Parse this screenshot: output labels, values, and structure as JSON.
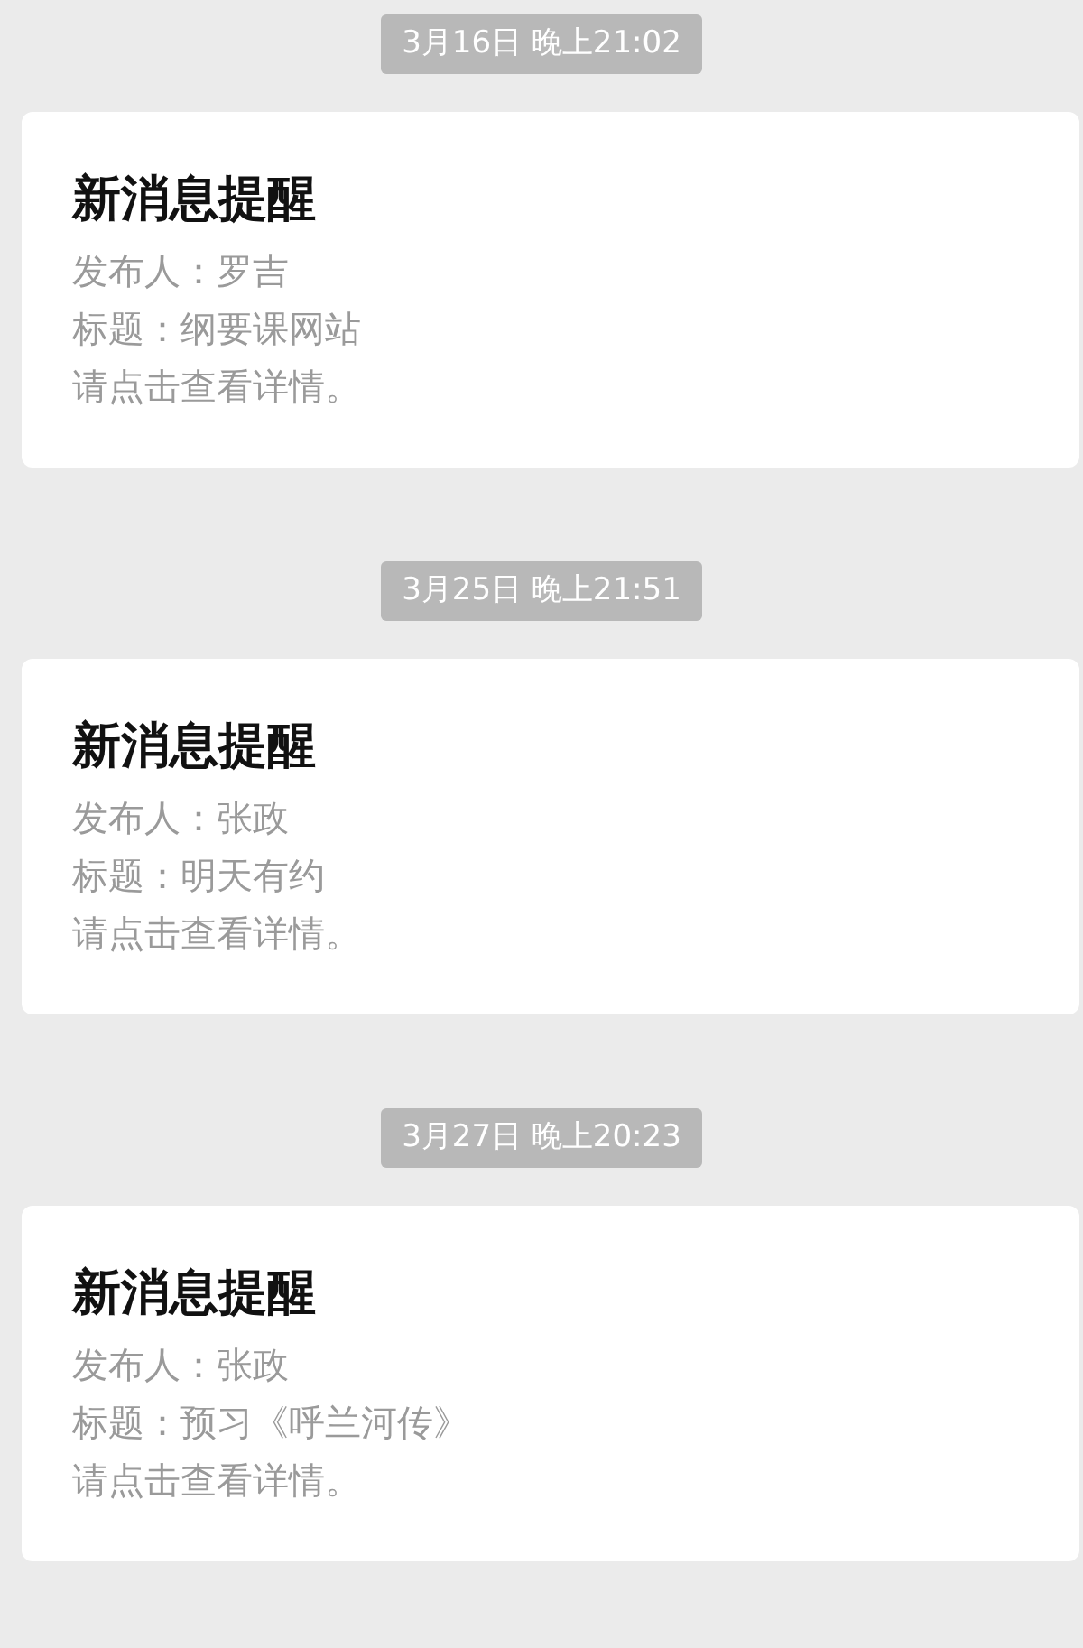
{
  "messages": [
    {
      "time": "3月16日 晚上21:02",
      "title": "新消息提醒",
      "lines": [
        "发布人：罗吉",
        "标题：纲要课网站",
        "请点击查看详情。"
      ]
    },
    {
      "time": "3月25日 晚上21:51",
      "title": "新消息提醒",
      "lines": [
        "发布人：张政",
        "标题：明天有约",
        "请点击查看详情。"
      ]
    },
    {
      "time": "3月27日 晚上20:23",
      "title": "新消息提醒",
      "lines": [
        "发布人：张政",
        "标题：预习《呼兰河传》",
        "请点击查看详情。"
      ]
    }
  ]
}
